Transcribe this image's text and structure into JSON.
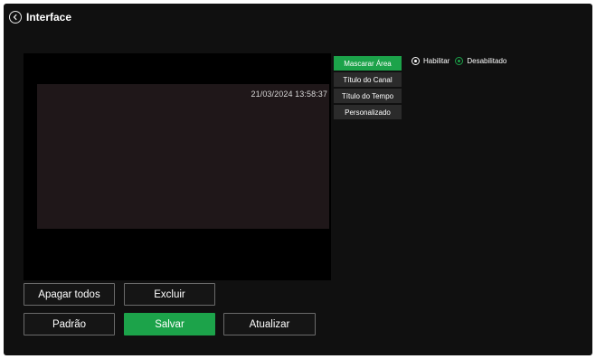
{
  "header": {
    "title": "Interface",
    "back_icon": "chevron-left-circle-icon"
  },
  "video": {
    "timestamp": "21/03/2024 13:58:37"
  },
  "side_menu": {
    "items": [
      {
        "label": "Mascarar Área",
        "active": true
      },
      {
        "label": "Título do Canal",
        "active": false
      },
      {
        "label": "Título do Tempo",
        "active": false
      },
      {
        "label": "Personalizado",
        "active": false
      }
    ]
  },
  "mask_option": {
    "enable_label": "Habilitar",
    "disable_label": "Desabilitado",
    "selected": "Desabilitado"
  },
  "actions": {
    "clear_all": "Apagar todos",
    "delete": "Excluir",
    "default": "Padrão",
    "save": "Salvar",
    "refresh": "Atualizar"
  },
  "colors": {
    "background": "#101010",
    "accent": "#1ca34a",
    "button_border": "#6a6a6a",
    "menu_item": "#2b2b2b"
  }
}
